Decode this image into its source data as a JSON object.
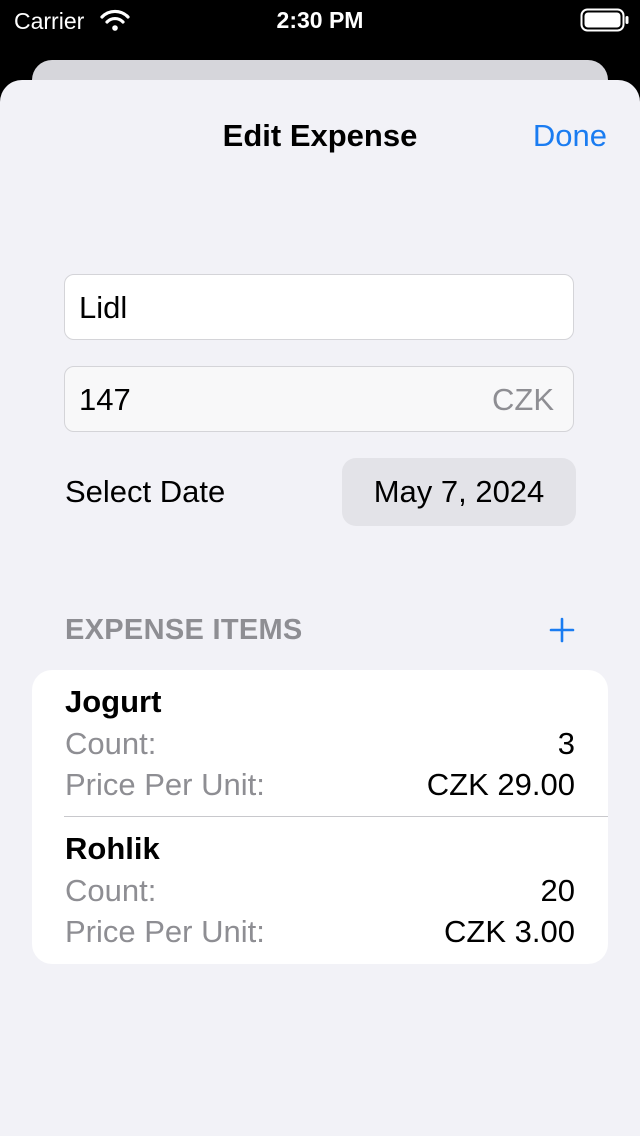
{
  "status_bar": {
    "carrier": "Carrier",
    "time": "2:30 PM",
    "icons": [
      "wifi-icon",
      "battery-icon"
    ]
  },
  "nav": {
    "title": "Edit Expense",
    "done_label": "Done"
  },
  "form": {
    "name_value": "Lidl",
    "amount_value": "147",
    "currency_suffix": "CZK",
    "date_label": "Select Date",
    "date_value": "May 7, 2024"
  },
  "items_section": {
    "header": "EXPENSE ITEMS",
    "add_icon": "plus-icon",
    "items": [
      {
        "name": "Jogurt",
        "count_label": "Count:",
        "count_value": "3",
        "price_label": "Price Per Unit:",
        "price_value": "CZK 29.00"
      },
      {
        "name": "Rohlik",
        "count_label": "Count:",
        "count_value": "20",
        "price_label": "Price Per Unit:",
        "price_value": "CZK 3.00"
      }
    ]
  },
  "colors": {
    "accent": "#1a7cf1",
    "background": "#f2f2f7",
    "secondary_text": "#8e8e93"
  }
}
